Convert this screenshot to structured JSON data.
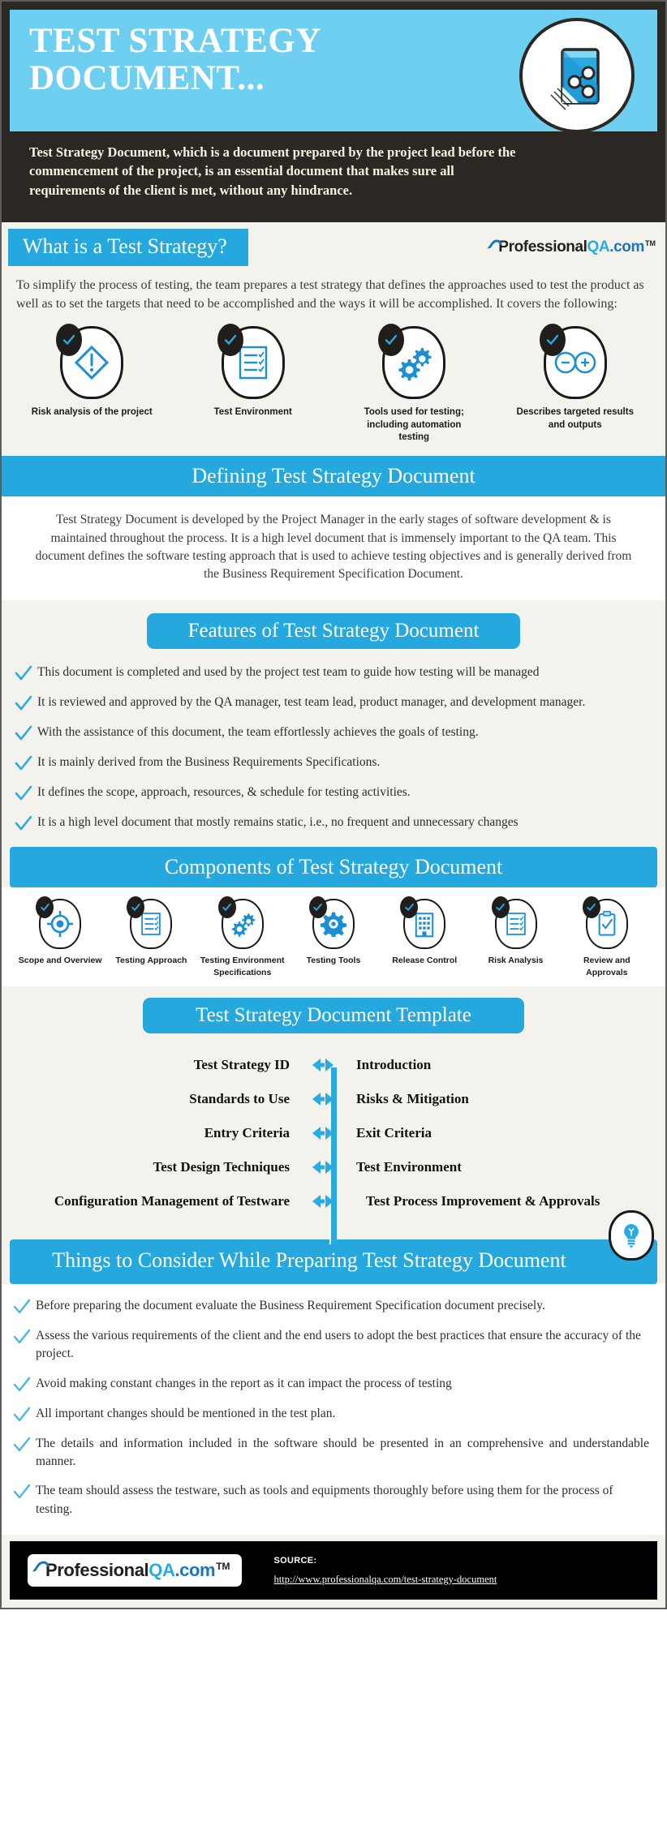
{
  "header": {
    "title": "TEST STRATEGY DOCUMENT...",
    "description": "Test Strategy Document, which is a document prepared by the project lead before the commencement of the project, is an essential document that makes sure all requirements of the client is met, without any hindrance.",
    "badge_icon": "share-document-icon"
  },
  "brand": {
    "name_part1": "Professional",
    "name_part2": "QA",
    "name_part3": ".com",
    "trademark": "TM"
  },
  "colors": {
    "banner_blue": "#6ecff0",
    "accent_blue": "#25a8dd",
    "icon_blue": "#1b8fd6",
    "dark": "#2b2722",
    "page_bg": "#f4f2ed"
  },
  "section_what": {
    "heading": "What is a Test Strategy?",
    "paragraph": "To simplify the process of testing, the team prepares a test strategy that defines the approaches used to test the product as well as to set the targets that need to be accomplished and the ways it will be accomplished. It covers the following:",
    "items": [
      {
        "label": "Risk analysis of the project",
        "icon": "warning-diamond-icon"
      },
      {
        "label": "Test Environment",
        "icon": "checklist-icon"
      },
      {
        "label": "Tools used for testing; including automation testing",
        "icon": "gears-icon"
      },
      {
        "label": "Describes targeted results and outputs",
        "icon": "infinity-plus-minus-icon"
      }
    ]
  },
  "section_defining": {
    "heading": "Defining Test Strategy Document",
    "paragraph_parts": [
      {
        "text": "Test Strategy Document is developed by the ",
        "bold": false
      },
      {
        "text": "Project Manager",
        "bold": true
      },
      {
        "text": " in the early stages of software development & is maintained throughout the process. It is a high level document that is immensely important to the QA team. ",
        "bold": false
      },
      {
        "text": "This document defines the software testing approach that is used to achieve testing objectives and is generally derived from the ",
        "bold": true
      },
      {
        "text": "Business Requirement Specification Document",
        "bold": true
      },
      {
        "text": ".",
        "bold": false
      }
    ],
    "paragraph_plain": "Test Strategy Document is developed by the Project Manager in the early stages of software development & is maintained throughout the process. It is a high level document that is immensely important to the QA team. This document defines the software testing approach that is used to achieve testing objectives and is generally derived from the Business Requirement Specification Document."
  },
  "section_features": {
    "heading": "Features of Test Strategy Document",
    "items": [
      "This document is completed and used by the project test team to guide how testing will be managed",
      "It is reviewed and approved by the QA manager, test team lead, product manager, and development manager.",
      "With the assistance of this document, the team effortlessly achieves the goals of testing.",
      "It is mainly derived from the Business Requirements Specifications.",
      "It defines the scope, approach, resources, & schedule for testing activities.",
      "It is a high level document that mostly remains static, i.e., no frequent and unnecessary changes"
    ]
  },
  "section_components": {
    "heading": "Components of Test Strategy Document",
    "items": [
      {
        "label": "Scope and Overview",
        "icon": "target-icon"
      },
      {
        "label": "Testing Approach",
        "icon": "checklist-icon"
      },
      {
        "label": "Testing Environment Specifications",
        "icon": "gears-icon"
      },
      {
        "label": "Testing Tools",
        "icon": "gear-icon"
      },
      {
        "label": "Release Control",
        "icon": "building-icon"
      },
      {
        "label": "Risk Analysis",
        "icon": "checklist-icon"
      },
      {
        "label": "Review and Approvals",
        "icon": "clipboard-check-icon"
      }
    ]
  },
  "section_template": {
    "heading": "Test Strategy Document Template",
    "rows": [
      {
        "left": "Test Strategy ID",
        "right": "Introduction"
      },
      {
        "left": "Standards to Use",
        "right": "Risks & Mitigation"
      },
      {
        "left": "Entry Criteria",
        "right": "Exit Criteria"
      },
      {
        "left": "Test Design Techniques",
        "right": "Test Environment"
      },
      {
        "left": "Configuration Management of Testware",
        "right": "Test Process Improvement & Approvals"
      }
    ],
    "badge_icon": "lightbulb-icon"
  },
  "section_consider": {
    "heading": "Things to Consider While Preparing Test Strategy Document",
    "items": [
      "Before preparing the document evaluate the Business Requirement Specification document precisely.",
      "Assess the various requirements of the client and the end users to adopt the best practices that ensure the accuracy of the project.",
      "Avoid making constant changes in the report as it can impact the process of testing",
      "All important changes should be mentioned in the test plan.",
      "The details and information included in the software should be presented in an comprehensive and understandable manner.",
      "The team should assess the testware, such as tools and equipments thoroughly before using them for the process of testing."
    ]
  },
  "footer": {
    "source_label": "SOURCE:",
    "source_url": "http://www.professionalqa.com/test-strategy-document"
  }
}
